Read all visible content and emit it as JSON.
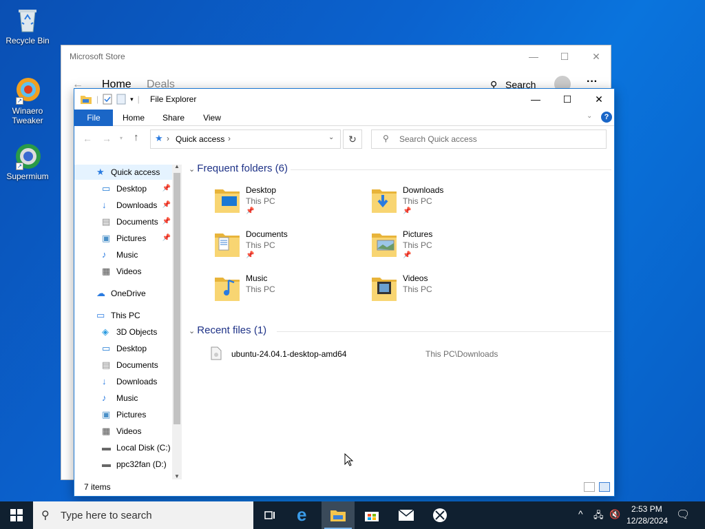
{
  "desktop": {
    "icons": [
      {
        "label": "Recycle Bin"
      },
      {
        "label": "Winaero Tweaker"
      },
      {
        "label": "Supermium"
      }
    ]
  },
  "store": {
    "title": "Microsoft Store",
    "nav": {
      "home": "Home",
      "deals": "Deals",
      "search": "Search"
    },
    "more": "···"
  },
  "explorer": {
    "title": "File Explorer",
    "ribbon_tabs": [
      "File",
      "Home",
      "Share",
      "View"
    ],
    "address": "Quick access",
    "search_placeholder": "Search Quick access",
    "nav_items": [
      {
        "label": "Quick access",
        "icon": "star-icon",
        "pinned": false,
        "indent": 0
      },
      {
        "label": "Desktop",
        "icon": "desktop-icon",
        "pinned": true,
        "indent": 1
      },
      {
        "label": "Downloads",
        "icon": "downloads-icon",
        "pinned": true,
        "indent": 1
      },
      {
        "label": "Documents",
        "icon": "documents-icon",
        "pinned": true,
        "indent": 1
      },
      {
        "label": "Pictures",
        "icon": "pictures-icon",
        "pinned": true,
        "indent": 1
      },
      {
        "label": "Music",
        "icon": "music-icon",
        "pinned": false,
        "indent": 1
      },
      {
        "label": "Videos",
        "icon": "videos-icon",
        "pinned": false,
        "indent": 1
      },
      {
        "label": "OneDrive",
        "icon": "cloud-icon",
        "pinned": false,
        "indent": 0
      },
      {
        "label": "This PC",
        "icon": "pc-icon",
        "pinned": false,
        "indent": 0
      },
      {
        "label": "3D Objects",
        "icon": "cube-icon",
        "pinned": false,
        "indent": 1
      },
      {
        "label": "Desktop",
        "icon": "desktop-icon",
        "pinned": false,
        "indent": 1
      },
      {
        "label": "Documents",
        "icon": "documents-icon",
        "pinned": false,
        "indent": 1
      },
      {
        "label": "Downloads",
        "icon": "downloads-icon",
        "pinned": false,
        "indent": 1
      },
      {
        "label": "Music",
        "icon": "music-icon",
        "pinned": false,
        "indent": 1
      },
      {
        "label": "Pictures",
        "icon": "pictures-icon",
        "pinned": false,
        "indent": 1
      },
      {
        "label": "Videos",
        "icon": "videos-icon",
        "pinned": false,
        "indent": 1
      },
      {
        "label": "Local Disk (C:)",
        "icon": "drive-icon",
        "pinned": false,
        "indent": 1
      },
      {
        "label": "ppc32fan (D:)",
        "icon": "drive-icon",
        "pinned": false,
        "indent": 1
      }
    ],
    "frequent_header": "Frequent folders (6)",
    "frequent": [
      {
        "name": "Desktop",
        "location": "This PC",
        "pinned": true
      },
      {
        "name": "Downloads",
        "location": "This PC",
        "pinned": true
      },
      {
        "name": "Documents",
        "location": "This PC",
        "pinned": true
      },
      {
        "name": "Pictures",
        "location": "This PC",
        "pinned": true
      },
      {
        "name": "Music",
        "location": "This PC",
        "pinned": false
      },
      {
        "name": "Videos",
        "location": "This PC",
        "pinned": false
      }
    ],
    "recent_header": "Recent files (1)",
    "recent": [
      {
        "name": "ubuntu-24.04.1-desktop-amd64",
        "path": "This PC\\Downloads"
      }
    ],
    "status": "7 items"
  },
  "taskbar": {
    "search_placeholder": "Type here to search",
    "time": "2:53 PM",
    "date": "12/28/2024"
  },
  "colors": {
    "accent": "#1a66c7",
    "group_header": "#1e3287",
    "taskbar": "#102030"
  }
}
